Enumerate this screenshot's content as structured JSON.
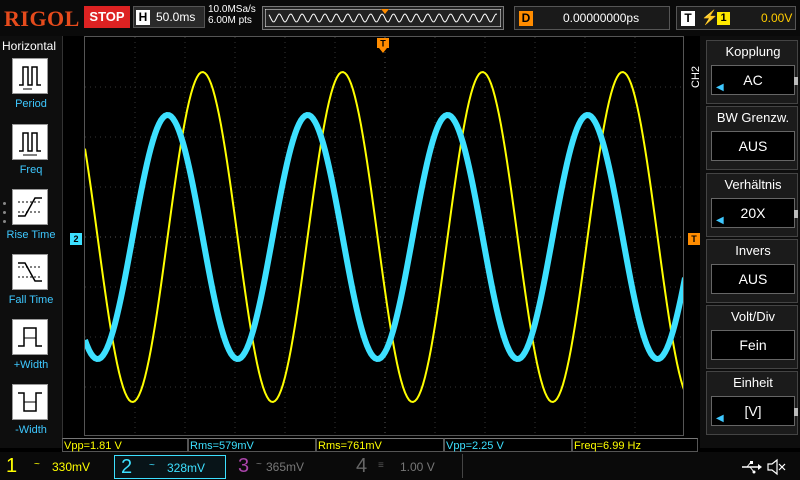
{
  "top": {
    "brand": "RIGOL",
    "run_status": "STOP",
    "timebase_label": "H",
    "timebase_value": "50.0ms",
    "sample_rate": "10.0MSa/s",
    "memory_depth": "6.00M pts",
    "trigger_pos_marker": "T",
    "delay_label": "D",
    "delay_value": "0.00000000ps",
    "trigger_label": "T",
    "trigger_edge": "rising-edge-icon",
    "trigger_channel": "1",
    "trigger_level": "0.00V"
  },
  "left_menu": {
    "title": "Horizontal",
    "items": [
      {
        "label": "Period",
        "icon": "period-icon"
      },
      {
        "label": "Freq",
        "icon": "freq-icon"
      },
      {
        "label": "Rise Time",
        "icon": "rise-time-icon"
      },
      {
        "label": "Fall Time",
        "icon": "fall-time-icon"
      },
      {
        "label": "+Width",
        "icon": "positive-width-icon"
      },
      {
        "label": "-Width",
        "icon": "negative-width-icon"
      }
    ]
  },
  "markers": {
    "ch2_marker": "2",
    "trigger_level_marker": "T"
  },
  "measurements": [
    {
      "text": "Vpp=1.81 V",
      "color": "#ffff00"
    },
    {
      "text": "Rms=579mV",
      "color": "#3de0ff"
    },
    {
      "text": "Rms=761mV",
      "color": "#ffff00"
    },
    {
      "text": "Vpp=2.25 V",
      "color": "#3de0ff"
    },
    {
      "text": "Freq=6.99 Hz",
      "color": "#ffff00"
    }
  ],
  "right_menu": {
    "channel_tag": "CH2",
    "items": [
      {
        "title": "Kopplung",
        "value": "AC",
        "has_arrow": true
      },
      {
        "title": "BW Grenzw.",
        "value": "AUS",
        "has_arrow": false
      },
      {
        "title": "Verhältnis",
        "value": "20X",
        "has_arrow": true
      },
      {
        "title": "Invers",
        "value": "AUS",
        "has_arrow": false
      },
      {
        "title": "Volt/Div",
        "value": "Fein",
        "has_arrow": false
      },
      {
        "title": "Einheit",
        "value": "[V]",
        "has_arrow": true
      }
    ]
  },
  "channels": [
    {
      "num": "1",
      "coupling": "~",
      "scale": "330mV",
      "color": "#ffff00",
      "active": true
    },
    {
      "num": "2",
      "coupling": "~",
      "scale": "328mV",
      "color": "#3de0ff",
      "active": true
    },
    {
      "num": "3",
      "coupling": "~",
      "scale": "365mV",
      "color": "#aa44aa",
      "active": false
    },
    {
      "num": "4",
      "coupling": "",
      "scale": "1.00 V",
      "color": "#666666",
      "active": false
    }
  ],
  "status_icons": [
    "usb-icon",
    "speaker-muted-icon"
  ],
  "colors": {
    "ch1": "#ffff00",
    "ch2": "#3de0ff",
    "trigger": "#ff8c00",
    "stop": "#dd2222",
    "brand": "#e64b1c"
  },
  "waveforms": {
    "ch1": {
      "vpp": 1.81,
      "freq_hz": 6.99
    },
    "ch2": {
      "vpp": 2.25,
      "freq_hz": 6.99
    }
  }
}
